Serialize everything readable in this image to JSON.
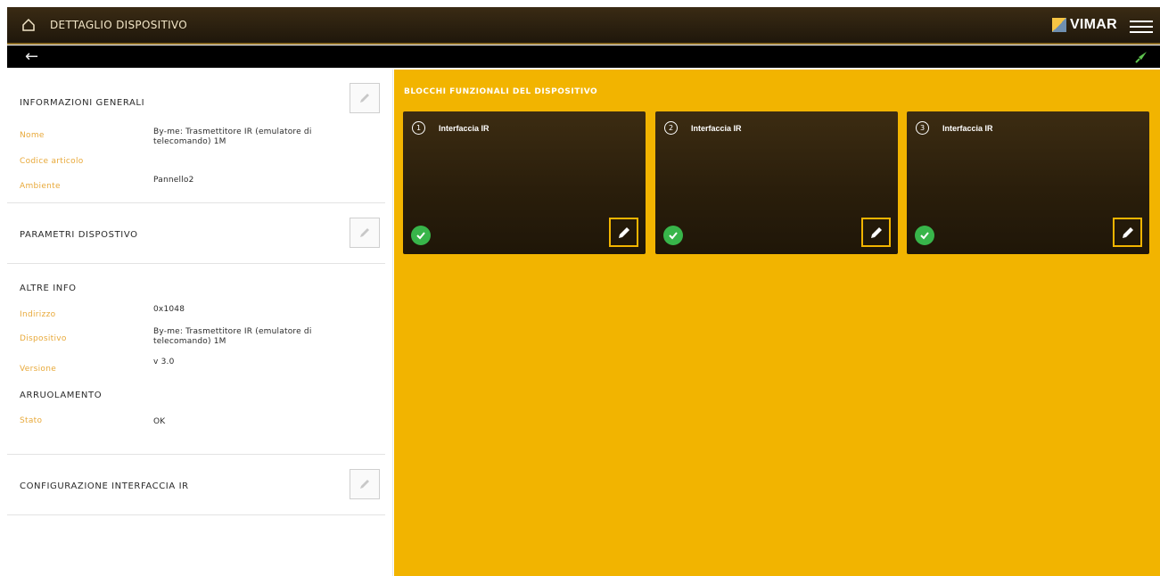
{
  "header": {
    "title": "DETTAGLIO DISPOSITIVO",
    "brand": "VIMAR",
    "icons": [
      "home-icon",
      "menu-icon"
    ]
  },
  "subbar": {
    "icons": [
      "back-arrow-icon",
      "connection-status-icon"
    ]
  },
  "general_info": {
    "title": "INFORMAZIONI GENERALI",
    "rows": [
      {
        "label": "Nome",
        "value": "By-me: Trasmettitore IR (emulatore di telecomando) 1M"
      },
      {
        "label": "Codice articolo",
        "value": ""
      },
      {
        "label": "Ambiente",
        "value": "Pannello2"
      }
    ]
  },
  "device_params": {
    "title": "PARAMETRI DISPOSTIVO"
  },
  "other_info": {
    "title": "ALTRE INFO",
    "rows": [
      {
        "label": "Indirizzo",
        "value": "0x1048"
      },
      {
        "label": "Dispositivo",
        "value": "By-me: Trasmettitore IR (emulatore di telecomando) 1M"
      },
      {
        "label": "Versione",
        "value": "v 3.0"
      }
    ]
  },
  "enrollment": {
    "title": "ARRUOLAMENTO",
    "rows": [
      {
        "label": "Stato",
        "value": "OK"
      }
    ]
  },
  "ir_config": {
    "title": "CONFIGURAZIONE INTERFACCIA IR"
  },
  "functional_blocks": {
    "title": "BLOCCHI FUNZIONALI DEL DISPOSITIVO",
    "cards": [
      {
        "number": "1",
        "label": "Interfaccia IR",
        "status": "ok"
      },
      {
        "number": "2",
        "label": "Interfaccia IR",
        "status": "ok"
      },
      {
        "number": "3",
        "label": "Interfaccia IR",
        "status": "ok"
      }
    ]
  },
  "colors": {
    "accent": "#f2b400",
    "label_orange": "#e8a93a",
    "header_dark": "#2a1e0b",
    "status_green": "#38b54a"
  }
}
